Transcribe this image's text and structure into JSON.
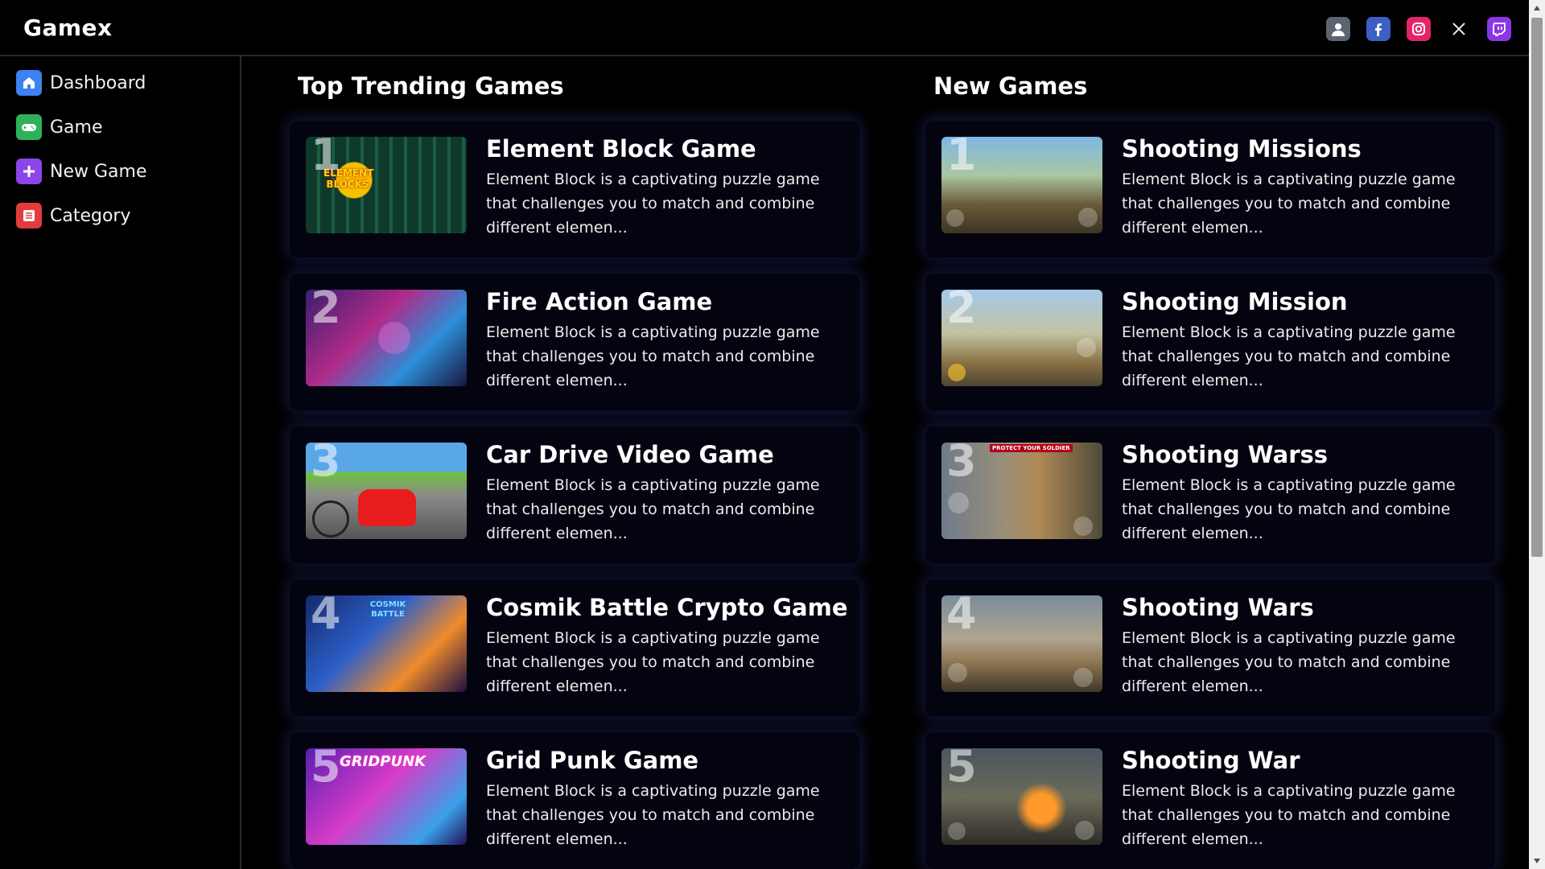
{
  "app": {
    "title": "Gamex"
  },
  "header": {
    "social": [
      {
        "icon": "user-icon"
      },
      {
        "icon": "facebook-icon"
      },
      {
        "icon": "instagram-icon"
      },
      {
        "icon": "x-icon"
      },
      {
        "icon": "twitch-icon"
      }
    ]
  },
  "sidebar": {
    "items": [
      {
        "label": "Dashboard",
        "icon": "home-icon",
        "color": "#3d82f0"
      },
      {
        "label": "Game",
        "icon": "gamepad-icon",
        "color": "#2fb15c"
      },
      {
        "label": "New Game",
        "icon": "plus-icon",
        "color": "#8b45e8"
      },
      {
        "label": "Category",
        "icon": "list-icon",
        "color": "#e23b3b"
      }
    ]
  },
  "trending": {
    "title": "Top Trending Games",
    "games": [
      {
        "rank": "1",
        "title": "Element Block Game",
        "description": "Element Block is a captivating puzzle game that challenges you to match and combine different elemen..."
      },
      {
        "rank": "2",
        "title": "Fire Action Game",
        "description": "Element Block is a captivating puzzle game that challenges you to match and combine different elemen..."
      },
      {
        "rank": "3",
        "title": "Car Drive Video Game",
        "description": "Element Block is a captivating puzzle game that challenges you to match and combine different elemen..."
      },
      {
        "rank": "4",
        "title": "Cosmik Battle Crypto Game",
        "description": "Element Block is a captivating puzzle game that challenges you to match and combine different elemen..."
      },
      {
        "rank": "5",
        "title": "Grid Punk Game",
        "description": "Element Block is a captivating puzzle game that challenges you to match and combine different elemen..."
      }
    ]
  },
  "new_games": {
    "title": "New Games",
    "games": [
      {
        "rank": "1",
        "title": "Shooting Missions",
        "description": "Element Block is a captivating puzzle game that challenges you to match and combine different elemen..."
      },
      {
        "rank": "2",
        "title": "Shooting Mission",
        "description": "Element Block is a captivating puzzle game that challenges you to match and combine different elemen..."
      },
      {
        "rank": "3",
        "title": "Shooting Warss",
        "description": "Element Block is a captivating puzzle game that challenges you to match and combine different elemen..."
      },
      {
        "rank": "4",
        "title": "Shooting Wars",
        "description": "Element Block is a captivating puzzle game that challenges you to match and combine different elemen..."
      },
      {
        "rank": "5",
        "title": "Shooting War",
        "description": "Element Block is a captivating puzzle game that challenges you to match and combine different elemen..."
      }
    ]
  },
  "thumbnail_text": {
    "element_blocks": "ELEMENT BLOCKS",
    "cosmik_battle": "COSMIK BATTLE",
    "gridpunk": "GRIDPUNK",
    "protect_soldier": "PROTECT YOUR SOLDIER"
  }
}
